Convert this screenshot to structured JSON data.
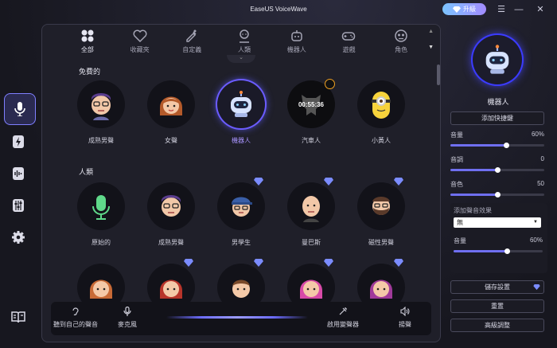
{
  "app": {
    "title": "EaseUS VoiceWave",
    "upgrade_label": "升級"
  },
  "categories": [
    {
      "label": "全部",
      "icon": "grid-icon",
      "active": true
    },
    {
      "label": "收藏夾",
      "icon": "heart-icon"
    },
    {
      "label": "自定義",
      "icon": "custom-icon"
    },
    {
      "label": "人類",
      "icon": "person-icon"
    },
    {
      "label": "機器人",
      "icon": "robot-icon"
    },
    {
      "label": "遊戲",
      "icon": "gamepad-icon"
    },
    {
      "label": "角色",
      "icon": "character-icon"
    }
  ],
  "sections": {
    "free": {
      "title": "免費的",
      "voices": [
        {
          "label": "成熟男聲",
          "icon": "man-glasses-avatar-icon"
        },
        {
          "label": "女聲",
          "icon": "woman-avatar-icon"
        },
        {
          "label": "機器人",
          "icon": "robot-avatar-icon",
          "selected": true
        },
        {
          "label": "汽車人",
          "icon": "autobot-avatar-icon",
          "timer": "00:55:36"
        },
        {
          "label": "小黃人",
          "icon": "minion-avatar-icon"
        }
      ]
    },
    "human": {
      "title": "人類",
      "voices": [
        {
          "label": "原始的",
          "icon": "microphone-avatar-icon"
        },
        {
          "label": "成熟男聲",
          "icon": "man-glasses-avatar-icon"
        },
        {
          "label": "男學生",
          "icon": "boy-student-avatar-icon",
          "premium": true
        },
        {
          "label": "曼巴斯",
          "icon": "bald-man-avatar-icon",
          "premium": true
        },
        {
          "label": "磁性男聲",
          "icon": "bearded-man-avatar-icon",
          "premium": true
        }
      ],
      "voices_row3": [
        {
          "icon": "girl-avatar-icon"
        },
        {
          "icon": "red-hair-woman-avatar-icon",
          "premium": true
        },
        {
          "icon": "child-avatar-icon",
          "premium": true
        },
        {
          "icon": "pink-hair-woman-avatar-icon",
          "premium": true
        },
        {
          "icon": "purple-hair-woman-avatar-icon",
          "premium": true
        }
      ]
    }
  },
  "bottom_bar": {
    "hear_self": "聽到自己的聲音",
    "microphone": "麥克風",
    "enable_changer": "啟用變聲器",
    "speaker": "揚聲"
  },
  "right_panel": {
    "voice_name": "機器人",
    "add_shortcut": "添加快捷鍵",
    "volume": {
      "label": "音量",
      "value": "60%",
      "level": 0.6
    },
    "pitch": {
      "label": "音調",
      "value": "0",
      "level": 0.5
    },
    "timbre": {
      "label": "音色",
      "value": "50",
      "level": 0.5
    },
    "effect": {
      "label": "添加聲音效果",
      "selected": "無",
      "volume": {
        "label": "音量",
        "value": "60%",
        "level": 0.6
      }
    },
    "save_settings": "儲存設置",
    "reset": "重置",
    "advanced": "高級調整"
  },
  "colors": {
    "accent": "#6b5cff",
    "premium": "#7b8cff",
    "timer_ring": "#f0a020"
  }
}
